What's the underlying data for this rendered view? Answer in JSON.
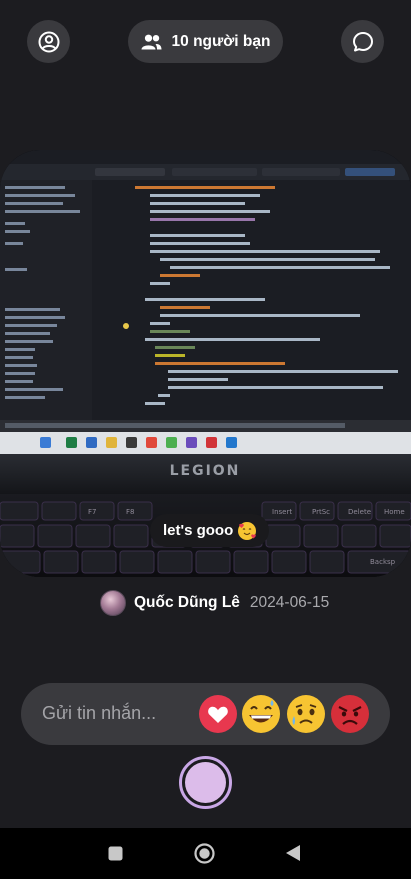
{
  "header": {
    "profile_icon": "person-circle-icon",
    "friends_icon": "people-icon",
    "friends_label": "10 người bạn",
    "chat_icon": "chat-bubble-icon"
  },
  "photo": {
    "description_icon": "laptop-photo",
    "caption": "let's gooo",
    "caption_emoji": "smiling-face-with-hearts",
    "laptop_brand": "LEGION"
  },
  "post": {
    "author_name": "Quốc Dũng Lê",
    "date": "2024-06-15"
  },
  "message_bar": {
    "placeholder": "Gửi tin nhắn...",
    "reactions": [
      "heart",
      "grinning-sweat",
      "anxious-sweat",
      "angry"
    ]
  },
  "colors": {
    "background": "#1c1c20",
    "pill": "#3a3a3e",
    "heart": "#e8384f",
    "angry": "#d62f3a",
    "shutter_ring": "#c9a7e6"
  },
  "nav": {
    "icons": [
      "recents-square-icon",
      "home-circle-icon",
      "back-triangle-icon"
    ]
  }
}
